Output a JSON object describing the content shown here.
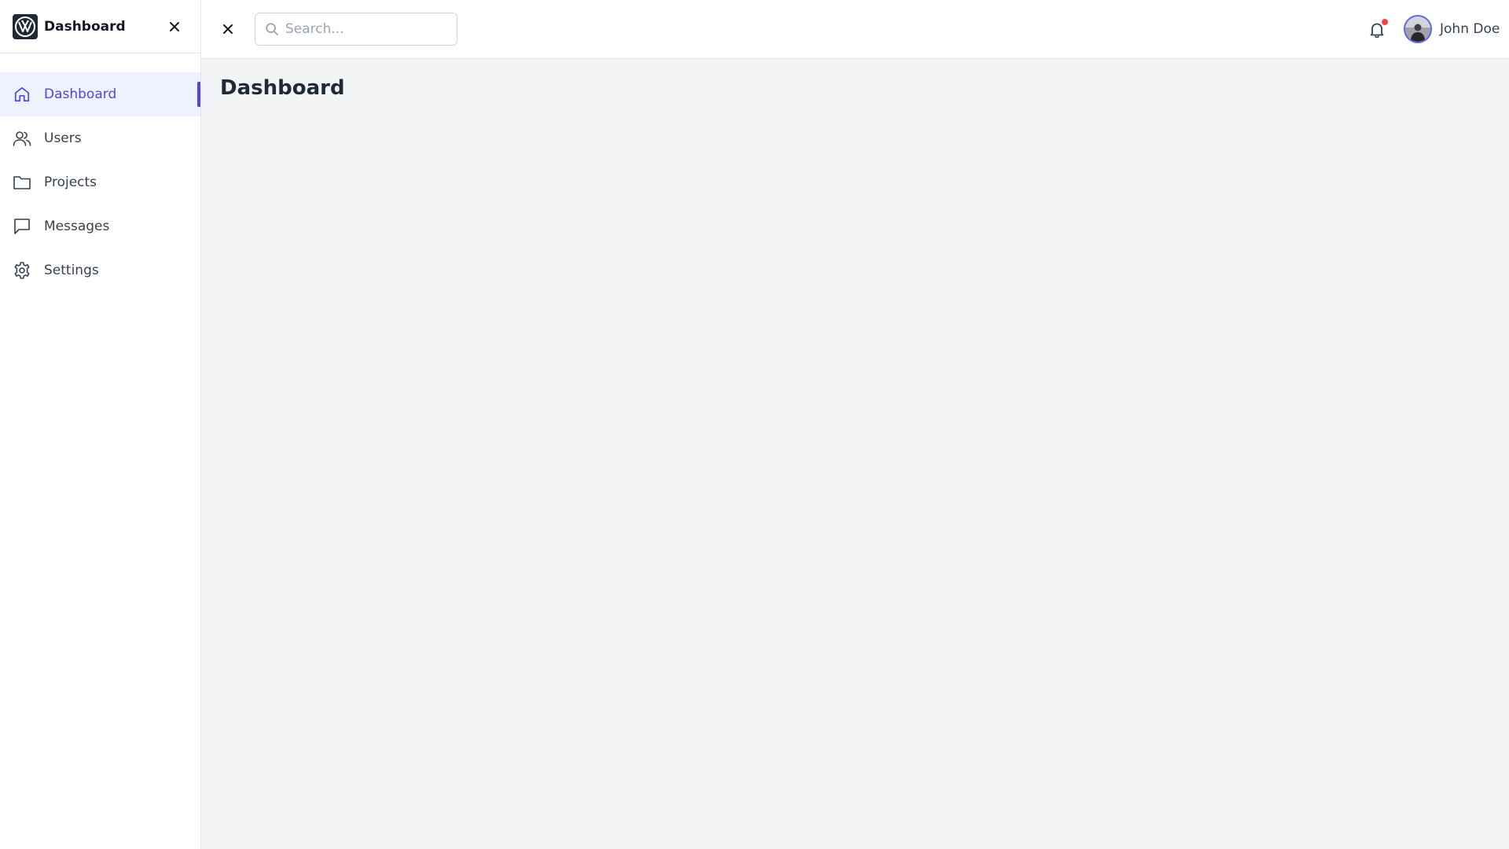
{
  "sidebar": {
    "brand": "Dashboard",
    "items": [
      {
        "label": "Dashboard",
        "icon": "home-icon",
        "active": true
      },
      {
        "label": "Users",
        "icon": "users-icon",
        "active": false
      },
      {
        "label": "Projects",
        "icon": "folder-icon",
        "active": false
      },
      {
        "label": "Messages",
        "icon": "message-icon",
        "active": false
      },
      {
        "label": "Settings",
        "icon": "gear-icon",
        "active": false
      }
    ]
  },
  "header": {
    "search_placeholder": "Search...",
    "user_name": "John Doe",
    "has_notification": true
  },
  "main": {
    "title": "Dashboard"
  },
  "colors": {
    "accent": "#4f46e5",
    "notification": "#ef4444",
    "background": "#f3f4f6"
  }
}
